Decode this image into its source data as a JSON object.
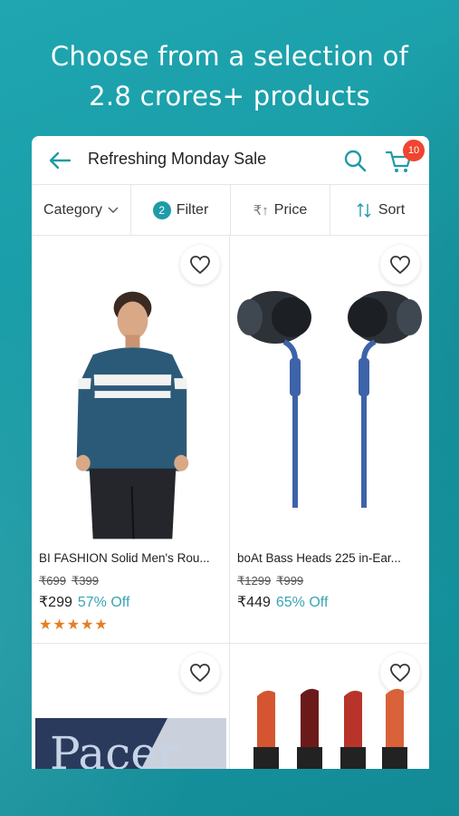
{
  "headline": {
    "line1": "Choose from a selection of",
    "line2": "2.8 crores+ products"
  },
  "appbar": {
    "title": "Refreshing Monday Sale",
    "cart_count": "10"
  },
  "filters": {
    "category": "Category",
    "filter_count": "2",
    "filter": "Filter",
    "price": "Price",
    "sort": "Sort"
  },
  "products": [
    {
      "name": "BI FASHION Solid Men's Rou...",
      "mrp1": "₹699",
      "mrp2": "₹399",
      "price": "₹299",
      "discount": "57% Off",
      "stars": "★★★★★"
    },
    {
      "name": "boAt Bass Heads 225 in-Ear...",
      "mrp1": "₹1299",
      "mrp2": "₹999",
      "price": "₹449",
      "discount": "65% Off"
    }
  ],
  "book_text": "Pacer",
  "colors": {
    "brand": "#1f9ba7",
    "badge": "#f0452f",
    "rating": "#e67e22",
    "discount": "#3aa4b3"
  }
}
